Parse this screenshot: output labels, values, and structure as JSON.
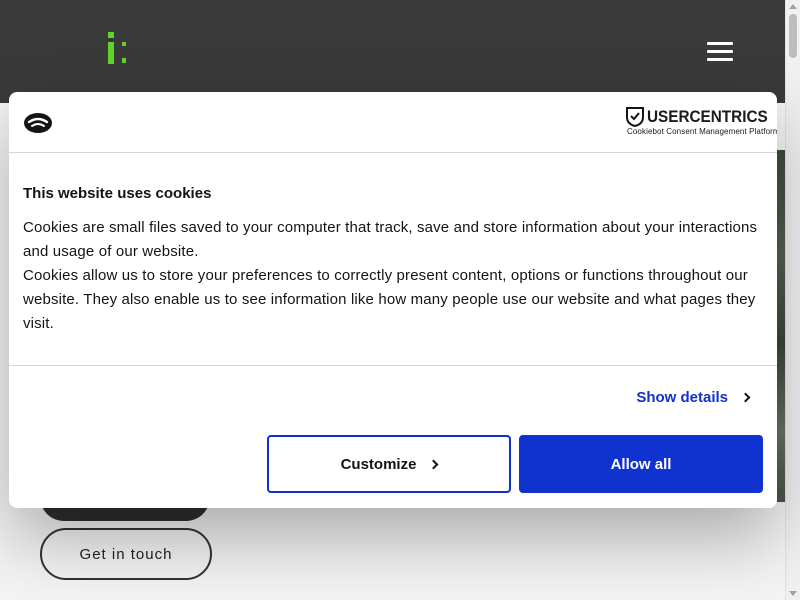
{
  "colors": {
    "topbar": "#3a3a3a",
    "logo_green": "#5fd52b",
    "accent_blue": "#1032cf",
    "text": "#141414"
  },
  "header": {
    "logo_icon": "brand-i-logo-icon",
    "menu_icon": "hamburger-menu-icon"
  },
  "dialog": {
    "cookiebot_icon": "cookiebot-logo-icon",
    "brand_name": "USERCENTRICS",
    "brand_tagline": "Cookiebot Consent Management Platform",
    "title": "This website uses cookies",
    "paragraph_1": "Cookies are small files saved to your computer that track, save and store information about your interactions and usage of our website.",
    "paragraph_2": "Cookies allow us to store your preferences to correctly present content, options or functions throughout our website. They also enable us to see information like how many people use our website and what pages they visit.",
    "show_details_label": "Show details",
    "customize_label": "Customize",
    "allow_all_label": "Allow all"
  },
  "page": {
    "get_in_touch_label": "Get in touch"
  }
}
